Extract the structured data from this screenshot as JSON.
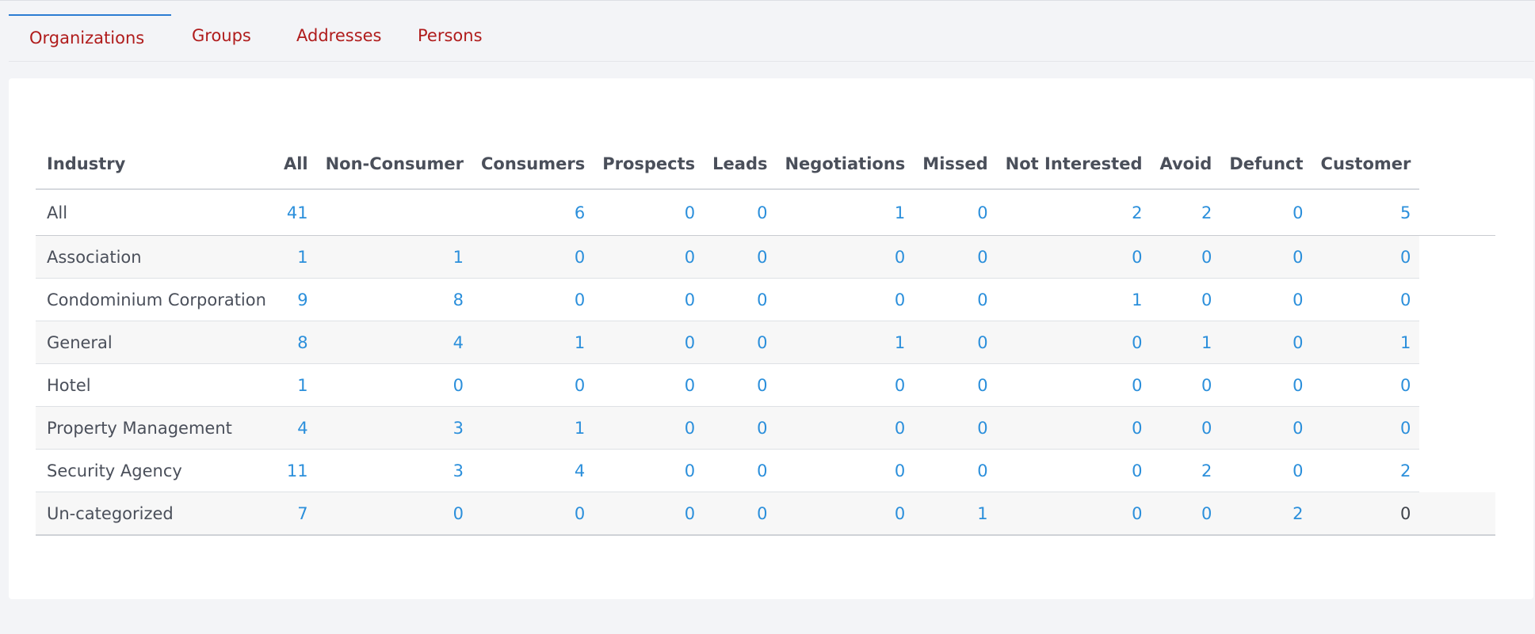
{
  "tabs": [
    {
      "label": "Organizations",
      "active": true
    },
    {
      "label": "Groups",
      "active": false
    },
    {
      "label": "Addresses",
      "active": false
    },
    {
      "label": "Persons",
      "active": false
    }
  ],
  "colors": {
    "tab_text": "#b01c1c",
    "active_tab_border": "#2b7cd3",
    "link_value": "#2b8fdb"
  },
  "table": {
    "headers": [
      "Industry",
      "All",
      "Non-Consumer",
      "Consumers",
      "Prospects",
      "Leads",
      "Negotiations",
      "Missed",
      "Not Interested",
      "Avoid",
      "Defunct",
      "Customer"
    ],
    "rows": [
      {
        "label": "All",
        "values": [
          "41",
          "",
          "6",
          "0",
          "0",
          "1",
          "0",
          "2",
          "2",
          "0",
          "5"
        ]
      },
      {
        "label": "Association",
        "values": [
          "1",
          "1",
          "0",
          "0",
          "0",
          "0",
          "0",
          "0",
          "0",
          "0",
          "0"
        ]
      },
      {
        "label": "Condominium Corporation",
        "values": [
          "9",
          "8",
          "0",
          "0",
          "0",
          "0",
          "0",
          "1",
          "0",
          "0",
          "0"
        ]
      },
      {
        "label": "General",
        "values": [
          "8",
          "4",
          "1",
          "0",
          "0",
          "1",
          "0",
          "0",
          "1",
          "0",
          "1"
        ]
      },
      {
        "label": "Hotel",
        "values": [
          "1",
          "0",
          "0",
          "0",
          "0",
          "0",
          "0",
          "0",
          "0",
          "0",
          "0"
        ]
      },
      {
        "label": "Property Management",
        "values": [
          "4",
          "3",
          "1",
          "0",
          "0",
          "0",
          "0",
          "0",
          "0",
          "0",
          "0"
        ]
      },
      {
        "label": "Security Agency",
        "values": [
          "11",
          "3",
          "4",
          "0",
          "0",
          "0",
          "0",
          "0",
          "2",
          "0",
          "2"
        ]
      },
      {
        "label": "Un-categorized",
        "values": [
          "7",
          "0",
          "0",
          "0",
          "0",
          "0",
          "1",
          "0",
          "0",
          "2",
          "0"
        ]
      }
    ]
  }
}
